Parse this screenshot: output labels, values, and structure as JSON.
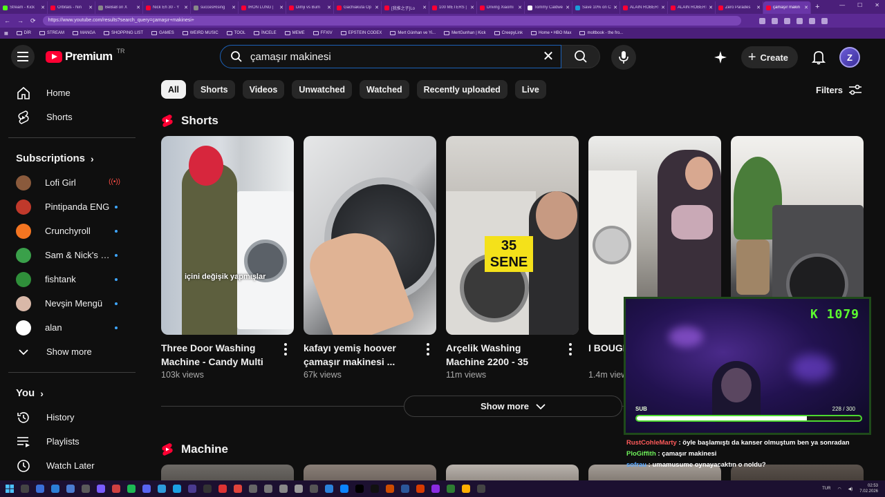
{
  "browser": {
    "tabs": [
      {
        "label": "Stream - Kick",
        "fav": "#53fc18"
      },
      {
        "label": "Orbitals - Nin",
        "fav": "#ff0033"
      },
      {
        "label": "BeBa8 on X",
        "fav": "#888888"
      },
      {
        "label": "Nick Eh 30 - Y",
        "fav": "#ff0033"
      },
      {
        "label": "succesRising",
        "fav": "#888888"
      },
      {
        "label": "IRON LUNG |",
        "fav": "#ff0033"
      },
      {
        "label": "Dimji vs Bum",
        "fav": "#ff0033"
      },
      {
        "label": "Gachiakuta Op",
        "fav": "#ff0033"
      },
      {
        "label": "[我推之子]Lo",
        "fav": "#ff0033"
      },
      {
        "label": "100 METERS |",
        "fav": "#ff0033"
      },
      {
        "label": "Driving Xiaomi",
        "fav": "#ff0033"
      },
      {
        "label": "Tommy Caldwe",
        "fav": "#ffffff"
      },
      {
        "label": "Save 10% on C",
        "fav": "#1b9cd8"
      },
      {
        "label": "ALAIN ROBERT",
        "fav": "#ff0033"
      },
      {
        "label": "ALAIN ROBERT",
        "fav": "#ff0033"
      },
      {
        "label": "Zero Parades",
        "fav": "#ff0033"
      },
      {
        "label": "çamaşır makin",
        "fav": "#ff0033",
        "active": true
      }
    ],
    "url": "https://www.youtube.com/results?search_query=çamaşır+makinesi+",
    "bookmarks": [
      "DİR",
      "STREAM",
      "MANGA",
      "SHOPPING LIST",
      "GAMES",
      "WEIRD MUSIC",
      "TOOL",
      "İNCELE",
      "MEME",
      "FFXIV",
      "EPSTEIN CODEX",
      "Mert Günhan ve Yi...",
      "MertGunhan | Kick",
      "CreepyLink",
      "Home • HBO Max",
      "moltbook - the fro..."
    ]
  },
  "masthead": {
    "logo_text": "Premium",
    "country": "TR",
    "search_value": "çamaşır makinesi",
    "create_label": "Create",
    "avatar_letter": "Z"
  },
  "sidebar": {
    "home": "Home",
    "shorts": "Shorts",
    "subscriptions_label": "Subscriptions",
    "subscriptions": [
      {
        "name": "Lofi Girl",
        "color": "#8a5a3c",
        "status": "live"
      },
      {
        "name": "Pintipanda ENG",
        "color": "#c0392b",
        "status": "new"
      },
      {
        "name": "Crunchyroll",
        "color": "#f47521",
        "status": "new"
      },
      {
        "name": "Sam & Nick's Per...",
        "color": "#3aa04a",
        "status": "new"
      },
      {
        "name": "fishtank",
        "color": "#2f8f3a",
        "status": "new"
      },
      {
        "name": "Nevşin Mengü",
        "color": "#d9b8a8",
        "status": "new"
      },
      {
        "name": "alan",
        "color": "#ffffff",
        "status": "new"
      }
    ],
    "show_more": "Show more",
    "you_label": "You",
    "history": "History",
    "playlists": "Playlists",
    "watch_later": "Watch Later"
  },
  "chips": [
    "All",
    "Shorts",
    "Videos",
    "Unwatched",
    "Watched",
    "Recently uploaded",
    "Live"
  ],
  "filters_label": "Filters",
  "shorts_shelf": {
    "title": "Shorts",
    "cards": [
      {
        "title": "Three Door Washing Machine - Candy Multi ...",
        "views": "103k views",
        "overlay": "içini değişik yapmışlar"
      },
      {
        "title": "kafayı yemiş hoover çamaşır makinesi ...",
        "views": "67k views",
        "overlay": ""
      },
      {
        "title": "Arçelik Washing Machine 2200 - 35 Years Old ...",
        "views": "11m views",
        "overlay": "35 SENE"
      },
      {
        "title": "I BOUGHT MACHIN",
        "views": "1.4m views",
        "overlay": ""
      },
      {
        "title": "",
        "views": "",
        "overlay": ""
      }
    ],
    "show_more": "Show more"
  },
  "machine_shelf": {
    "title": "Machine"
  },
  "overlay": {
    "score": "K 1079",
    "sub_label": "SUB",
    "sub_value": "228 / 300",
    "sub_progress": 0.76,
    "chat": [
      {
        "user": "RustCohleMarty",
        "msg": "öyle başlamıştı da kanser olmuştum ben ya sonradan",
        "cls": "u1"
      },
      {
        "user": "PloGiffith",
        "msg": "çamaşır makinesi",
        "cls": "u2"
      },
      {
        "user": "sofrau",
        "msg": "umamusume oynayacaktın o noldu?",
        "cls": "u3"
      }
    ]
  },
  "taskbar": {
    "lang": "TUR",
    "time": "02:53",
    "date": "7.02.2026"
  }
}
